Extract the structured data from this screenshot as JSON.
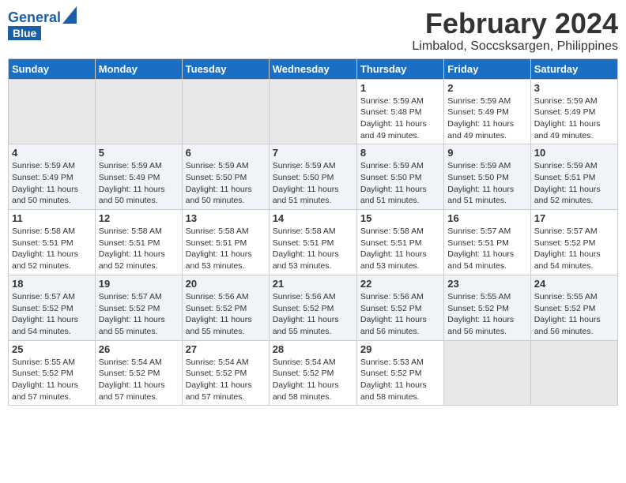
{
  "header": {
    "logo_line1": "General",
    "logo_line2": "Blue",
    "title": "February 2024",
    "subtitle": "Limbalod, Soccsksargen, Philippines"
  },
  "days_of_week": [
    "Sunday",
    "Monday",
    "Tuesday",
    "Wednesday",
    "Thursday",
    "Friday",
    "Saturday"
  ],
  "weeks": [
    [
      {
        "day": "",
        "info": ""
      },
      {
        "day": "",
        "info": ""
      },
      {
        "day": "",
        "info": ""
      },
      {
        "day": "",
        "info": ""
      },
      {
        "day": "1",
        "info": "Sunrise: 5:59 AM\nSunset: 5:48 PM\nDaylight: 11 hours and 49 minutes."
      },
      {
        "day": "2",
        "info": "Sunrise: 5:59 AM\nSunset: 5:49 PM\nDaylight: 11 hours and 49 minutes."
      },
      {
        "day": "3",
        "info": "Sunrise: 5:59 AM\nSunset: 5:49 PM\nDaylight: 11 hours and 49 minutes."
      }
    ],
    [
      {
        "day": "4",
        "info": "Sunrise: 5:59 AM\nSunset: 5:49 PM\nDaylight: 11 hours and 50 minutes."
      },
      {
        "day": "5",
        "info": "Sunrise: 5:59 AM\nSunset: 5:49 PM\nDaylight: 11 hours and 50 minutes."
      },
      {
        "day": "6",
        "info": "Sunrise: 5:59 AM\nSunset: 5:50 PM\nDaylight: 11 hours and 50 minutes."
      },
      {
        "day": "7",
        "info": "Sunrise: 5:59 AM\nSunset: 5:50 PM\nDaylight: 11 hours and 51 minutes."
      },
      {
        "day": "8",
        "info": "Sunrise: 5:59 AM\nSunset: 5:50 PM\nDaylight: 11 hours and 51 minutes."
      },
      {
        "day": "9",
        "info": "Sunrise: 5:59 AM\nSunset: 5:50 PM\nDaylight: 11 hours and 51 minutes."
      },
      {
        "day": "10",
        "info": "Sunrise: 5:59 AM\nSunset: 5:51 PM\nDaylight: 11 hours and 52 minutes."
      }
    ],
    [
      {
        "day": "11",
        "info": "Sunrise: 5:58 AM\nSunset: 5:51 PM\nDaylight: 11 hours and 52 minutes."
      },
      {
        "day": "12",
        "info": "Sunrise: 5:58 AM\nSunset: 5:51 PM\nDaylight: 11 hours and 52 minutes."
      },
      {
        "day": "13",
        "info": "Sunrise: 5:58 AM\nSunset: 5:51 PM\nDaylight: 11 hours and 53 minutes."
      },
      {
        "day": "14",
        "info": "Sunrise: 5:58 AM\nSunset: 5:51 PM\nDaylight: 11 hours and 53 minutes."
      },
      {
        "day": "15",
        "info": "Sunrise: 5:58 AM\nSunset: 5:51 PM\nDaylight: 11 hours and 53 minutes."
      },
      {
        "day": "16",
        "info": "Sunrise: 5:57 AM\nSunset: 5:51 PM\nDaylight: 11 hours and 54 minutes."
      },
      {
        "day": "17",
        "info": "Sunrise: 5:57 AM\nSunset: 5:52 PM\nDaylight: 11 hours and 54 minutes."
      }
    ],
    [
      {
        "day": "18",
        "info": "Sunrise: 5:57 AM\nSunset: 5:52 PM\nDaylight: 11 hours and 54 minutes."
      },
      {
        "day": "19",
        "info": "Sunrise: 5:57 AM\nSunset: 5:52 PM\nDaylight: 11 hours and 55 minutes."
      },
      {
        "day": "20",
        "info": "Sunrise: 5:56 AM\nSunset: 5:52 PM\nDaylight: 11 hours and 55 minutes."
      },
      {
        "day": "21",
        "info": "Sunrise: 5:56 AM\nSunset: 5:52 PM\nDaylight: 11 hours and 55 minutes."
      },
      {
        "day": "22",
        "info": "Sunrise: 5:56 AM\nSunset: 5:52 PM\nDaylight: 11 hours and 56 minutes."
      },
      {
        "day": "23",
        "info": "Sunrise: 5:55 AM\nSunset: 5:52 PM\nDaylight: 11 hours and 56 minutes."
      },
      {
        "day": "24",
        "info": "Sunrise: 5:55 AM\nSunset: 5:52 PM\nDaylight: 11 hours and 56 minutes."
      }
    ],
    [
      {
        "day": "25",
        "info": "Sunrise: 5:55 AM\nSunset: 5:52 PM\nDaylight: 11 hours and 57 minutes."
      },
      {
        "day": "26",
        "info": "Sunrise: 5:54 AM\nSunset: 5:52 PM\nDaylight: 11 hours and 57 minutes."
      },
      {
        "day": "27",
        "info": "Sunrise: 5:54 AM\nSunset: 5:52 PM\nDaylight: 11 hours and 57 minutes."
      },
      {
        "day": "28",
        "info": "Sunrise: 5:54 AM\nSunset: 5:52 PM\nDaylight: 11 hours and 58 minutes."
      },
      {
        "day": "29",
        "info": "Sunrise: 5:53 AM\nSunset: 5:52 PM\nDaylight: 11 hours and 58 minutes."
      },
      {
        "day": "",
        "info": ""
      },
      {
        "day": "",
        "info": ""
      }
    ]
  ]
}
